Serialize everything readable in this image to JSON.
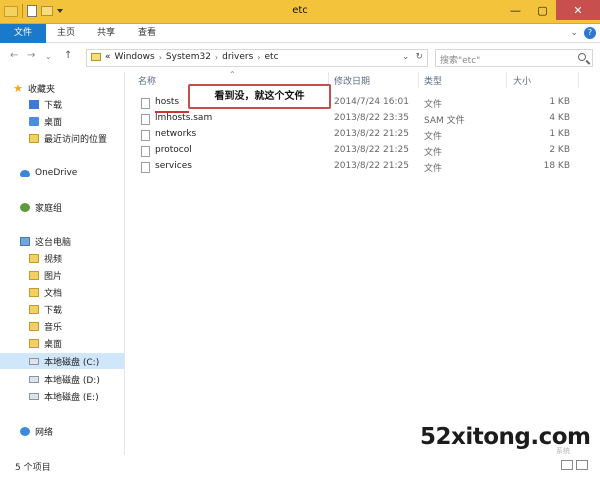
{
  "window": {
    "title": "etc",
    "minimize": "—",
    "maximize": "▢",
    "close": "✕"
  },
  "ribbon": {
    "tabs": [
      "文件",
      "主页",
      "共享",
      "查看"
    ]
  },
  "navigation": {
    "back": "←",
    "forward": "→",
    "history": "⌄",
    "up": "↑",
    "address": {
      "prefix": "«",
      "crumbs": [
        "Windows",
        "System32",
        "drivers",
        "etc"
      ],
      "separator": "›"
    },
    "search_placeholder": "搜索\"etc\""
  },
  "sidebar": {
    "items": [
      {
        "label": "收藏夹"
      },
      {
        "label": "下载"
      },
      {
        "label": "桌面"
      },
      {
        "label": "最近访问的位置"
      },
      {
        "label": "OneDrive"
      },
      {
        "label": "家庭组"
      },
      {
        "label": "这台电脑"
      },
      {
        "label": "视频"
      },
      {
        "label": "图片"
      },
      {
        "label": "文档"
      },
      {
        "label": "下载"
      },
      {
        "label": "音乐"
      },
      {
        "label": "桌面"
      },
      {
        "label": "本地磁盘 (C:)"
      },
      {
        "label": "本地磁盘 (D:)"
      },
      {
        "label": "本地磁盘 (E:)"
      },
      {
        "label": "网络"
      }
    ]
  },
  "columns": {
    "name": "名称",
    "date": "修改日期",
    "type": "类型",
    "size": "大小"
  },
  "files": [
    {
      "name": "hosts",
      "date": "2014/7/24 16:01",
      "type": "文件",
      "size": "1 KB"
    },
    {
      "name": "lmhosts.sam",
      "date": "2013/8/22 23:35",
      "type": "SAM 文件",
      "size": "4 KB"
    },
    {
      "name": "networks",
      "date": "2013/8/22 21:25",
      "type": "文件",
      "size": "1 KB"
    },
    {
      "name": "protocol",
      "date": "2013/8/22 21:25",
      "type": "文件",
      "size": "2 KB"
    },
    {
      "name": "services",
      "date": "2013/8/22 21:25",
      "type": "文件",
      "size": "18 KB"
    }
  ],
  "annotation": "看到没，就这个文件",
  "status": {
    "item_count": "5 个项目"
  },
  "watermark": {
    "site": "52xitong.com",
    "faint": "系统"
  },
  "colors": {
    "title_bar": "#f3c43b",
    "file_tab": "#1979ca",
    "selected_drive": "#cfe6fb",
    "callout_border": "#c64d4d"
  }
}
